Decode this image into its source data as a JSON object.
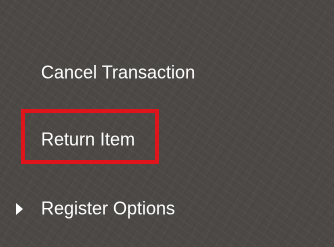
{
  "menu": {
    "items": [
      {
        "label": "Cancel Transaction"
      },
      {
        "label": "Return Item"
      },
      {
        "label": "Register Options",
        "icon": "caret-right-icon"
      }
    ]
  },
  "colors": {
    "background": "#4b4845",
    "text": "#ffffff",
    "highlight": "#e0141c"
  }
}
